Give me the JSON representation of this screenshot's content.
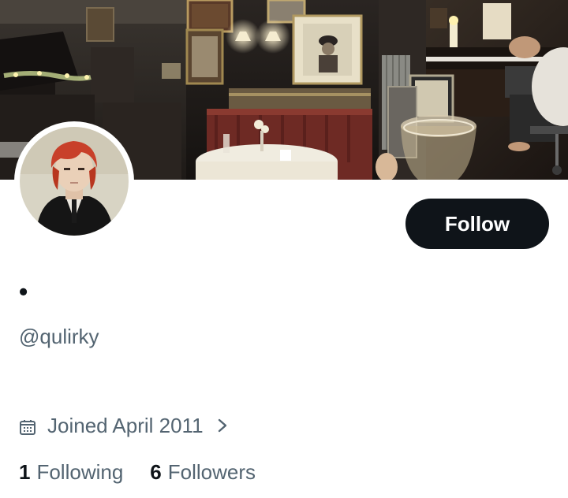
{
  "profile": {
    "display_name": "•",
    "handle": "@qulirky",
    "joined": "Joined April 2011",
    "follow_label": "Follow",
    "following_count": "1",
    "following_label": "Following",
    "followers_count": "6",
    "followers_label": "Followers"
  },
  "icons": {
    "calendar": "calendar-icon",
    "chevron": "chevron-right-icon"
  },
  "colors": {
    "follow_button_bg": "#0f1419",
    "secondary_text": "#536471",
    "primary_text": "#0f1419"
  }
}
